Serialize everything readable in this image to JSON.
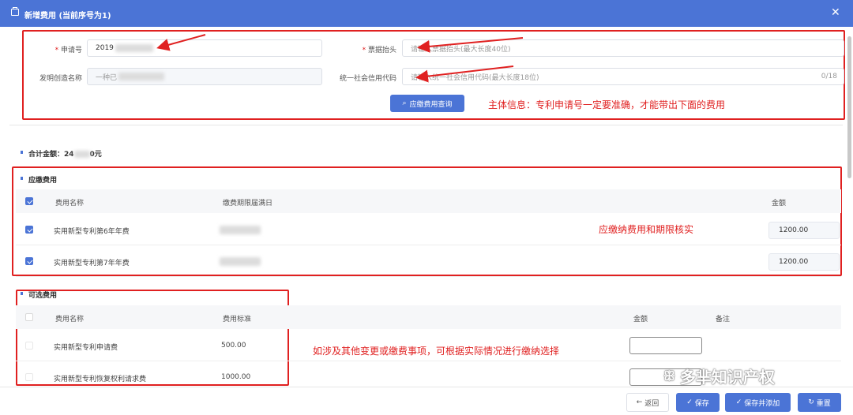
{
  "dialog": {
    "title": "新增费用 (当前序号为1)",
    "close_icon": "close-icon"
  },
  "form": {
    "application_no": {
      "label": "申请号",
      "value": "2019"
    },
    "invoice_title": {
      "label": "票据抬头",
      "placeholder": "请输入票据抬头(最大长度40位)"
    },
    "invention_name": {
      "label": "发明创造名称",
      "value": "一种已"
    },
    "credit_code": {
      "label": "统一社会信用代码",
      "placeholder": "请输入统一社会信用代码(最大长度18位)",
      "counter": "0/18"
    },
    "query_button": "应缴费用查询"
  },
  "annotations": {
    "main_info": "主体信息：专利申请号一定要准确，才能带出下面的费用",
    "due_fees": "应缴纳费用和期限核实",
    "optional_fees": "如涉及其他变更或缴费事项，可根据实际情况进行缴纳选择"
  },
  "total": {
    "label": "合计金额：",
    "value_prefix": "24",
    "value_suffix": "0元"
  },
  "due_section": {
    "title": "应缴费用",
    "headers": {
      "name": "费用名称",
      "deadline": "缴费期限届满日",
      "amount": "金额"
    },
    "rows": [
      {
        "checked": true,
        "name": "实用新型专利第6年年费",
        "amount": "1200.00"
      },
      {
        "checked": true,
        "name": "实用新型专利第7年年费",
        "amount": "1200.00"
      }
    ]
  },
  "optional_section": {
    "title": "可选费用",
    "headers": {
      "name": "费用名称",
      "standard": "费用标准",
      "amount": "金额",
      "remark": "备注"
    },
    "rows": [
      {
        "checked": false,
        "name": "实用新型专利申请费",
        "standard": "500.00"
      },
      {
        "checked": false,
        "name": "实用新型专利恢复权利请求费",
        "standard": "1000.00"
      }
    ]
  },
  "footer": {
    "back": "返回",
    "save": "保存",
    "save_add": "保存并添加",
    "reset": "重置"
  },
  "watermark": "多芈知识产权",
  "colors": {
    "primary": "#4b74d6",
    "annotation": "#e02020"
  }
}
